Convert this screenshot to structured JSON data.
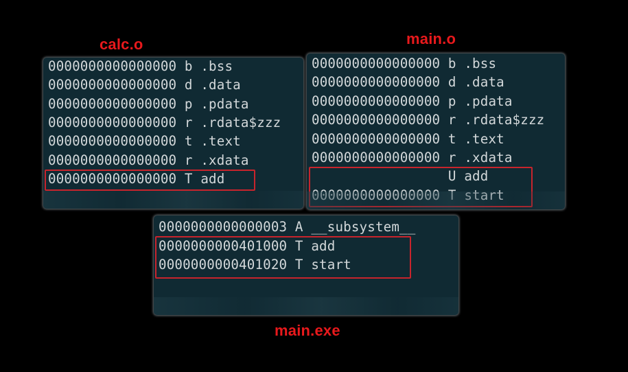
{
  "colors": {
    "background": "#000000",
    "panel": "#102a33",
    "text": "#d3d8da",
    "caption": "#e8191c",
    "highlight": "#c8242c"
  },
  "calc_o": {
    "caption": "calc.o",
    "rows": [
      "0000000000000000 b .bss",
      "0000000000000000 d .data",
      "0000000000000000 p .pdata",
      "0000000000000000 r .rdata$zzz",
      "0000000000000000 t .text",
      "0000000000000000 r .xdata",
      "0000000000000000 T add"
    ]
  },
  "main_o": {
    "caption": "main.o",
    "rows": [
      "0000000000000000 b .bss",
      "0000000000000000 d .data",
      "0000000000000000 p .pdata",
      "0000000000000000 r .rdata$zzz",
      "0000000000000000 t .text",
      "0000000000000000 r .xdata",
      "                 U add",
      "0000000000000000 T start"
    ]
  },
  "main_exe": {
    "caption": "main.exe",
    "rows": [
      "0000000000000003 A __subsystem__",
      "0000000000401000 T add",
      "0000000000401020 T start"
    ]
  }
}
